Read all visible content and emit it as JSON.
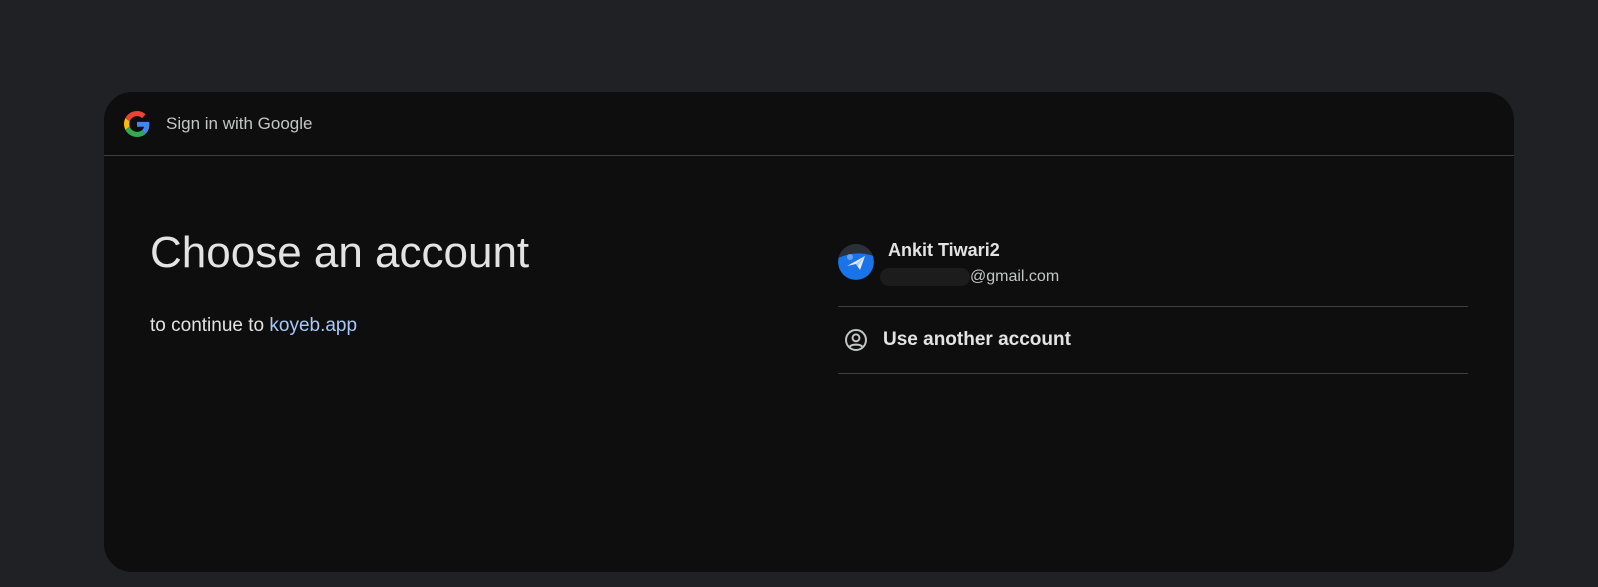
{
  "header": {
    "title": "Sign in with Google",
    "logo_icon": "google-g-icon"
  },
  "main": {
    "title": "Choose an account",
    "subtitle_prefix": "to continue to",
    "app_name": "koyeb.app"
  },
  "accounts": [
    {
      "name": "Ankit Tiwari2",
      "email_visible": "@gmail.com",
      "avatar_icon": "avatar"
    }
  ],
  "use_another": {
    "label": "Use another account",
    "icon": "person-circle-icon"
  },
  "colors": {
    "page_bg": "#202124",
    "card_bg": "#0e0e0e",
    "link": "#a8c7fa",
    "text": "#e3e3e3"
  }
}
